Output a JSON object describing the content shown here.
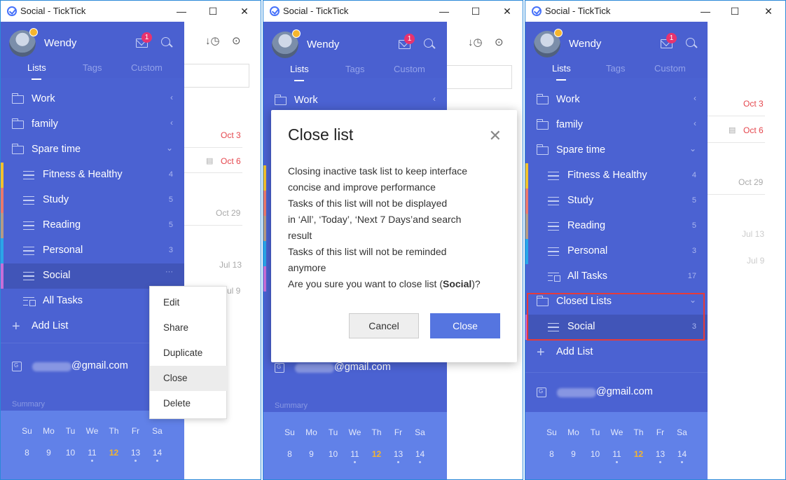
{
  "window_title": "Social - TickTick",
  "window_controls": {
    "minimize": "—",
    "maximize": "☐",
    "close": "✕"
  },
  "user": {
    "name": "Wendy",
    "notification_count": "1"
  },
  "tabs": [
    "Lists",
    "Tags",
    "Custom"
  ],
  "lists": {
    "work": "Work",
    "family": "family",
    "spare_time": "Spare time",
    "items": [
      {
        "label": "Fitness & Healthy",
        "count": "4",
        "color": "#f2c12e"
      },
      {
        "label": "Study",
        "count": "5",
        "color": "#e97a6e"
      },
      {
        "label": "Reading",
        "count": "5",
        "color": "#b59b86"
      },
      {
        "label": "Personal",
        "count": "3",
        "color": "#2ba6e8"
      },
      {
        "label": "Social",
        "count": "3",
        "color": "#c76ed8"
      }
    ],
    "all_tasks": "All Tasks",
    "all_tasks_count": "17",
    "closed_lists": "Closed Lists",
    "add_list": "Add List",
    "more_icon": "···"
  },
  "account": {
    "email_suffix": "@gmail.com",
    "summary": "Summary"
  },
  "calendar": {
    "weekdays": [
      "Su",
      "Mo",
      "Tu",
      "We",
      "Th",
      "Fr",
      "Sa"
    ],
    "days": [
      "8",
      "9",
      "10",
      "11",
      "12",
      "13",
      "14"
    ],
    "today": "12"
  },
  "main": {
    "dates": [
      "Oct 3",
      "Oct 6",
      "Oct 29",
      "Jul 13",
      "Jul 9"
    ]
  },
  "context_menu": [
    "Edit",
    "Share",
    "Duplicate",
    "Close",
    "Delete"
  ],
  "dialog": {
    "title": "Close list",
    "body_lines": [
      "Closing inactive task list to keep interface",
      "concise and improve performance",
      "Tasks of this list will not be displayed",
      "in ‘All’, ‘Today’, ‘Next 7 Days’and search",
      "result",
      "Tasks of this list will not be reminded",
      "anymore"
    ],
    "question_prefix": "Are you sure you want to close list (",
    "question_name": "Social",
    "question_suffix": ")?",
    "cancel": "Cancel",
    "confirm": "Close"
  },
  "colors": {
    "sidebar": "#4b62d2",
    "calendar": "#6181e8",
    "accent": "#5575e0",
    "highlight_box": "#e53b3b"
  }
}
